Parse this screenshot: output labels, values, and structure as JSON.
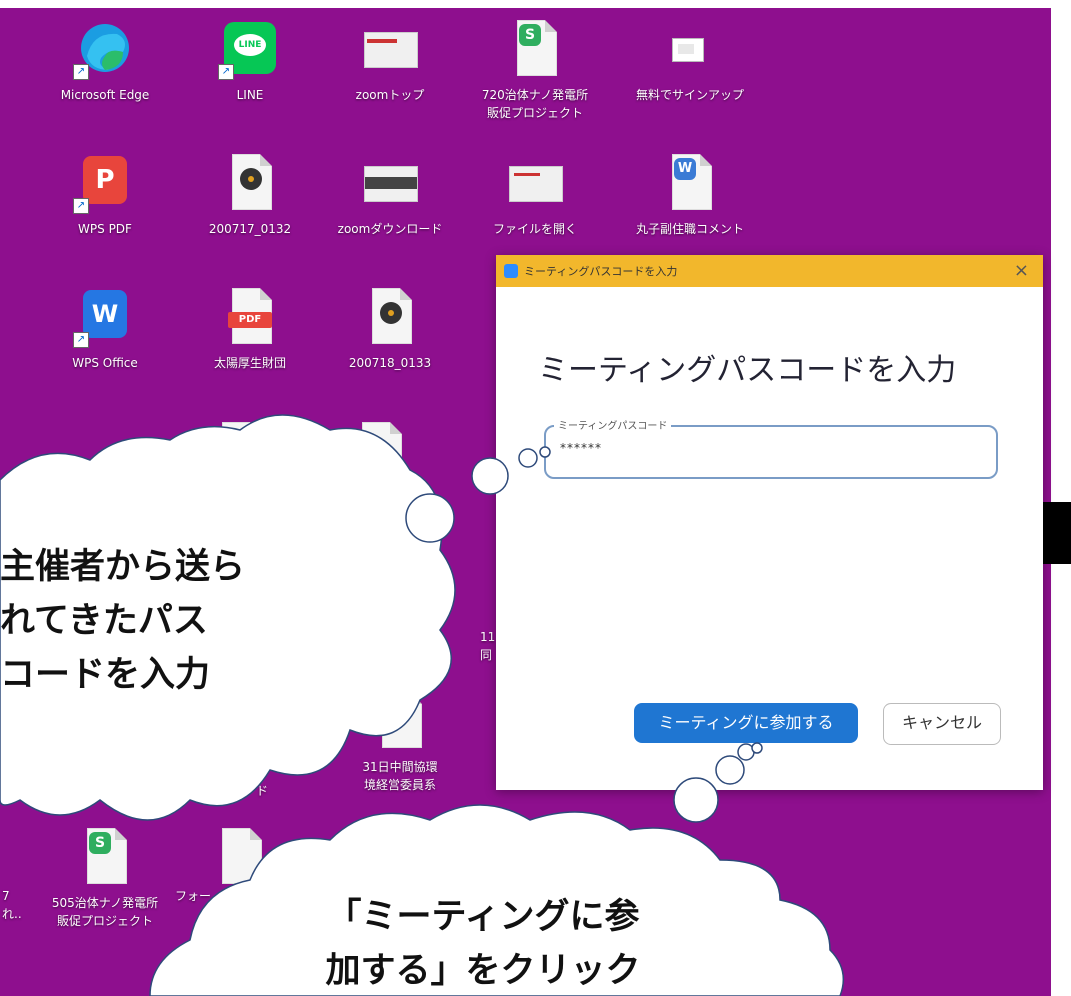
{
  "desktop": {
    "background_color": "#8e0f8e",
    "icons": [
      {
        "name": "desktop-icon-edge",
        "label": "Microsoft Edge"
      },
      {
        "name": "desktop-icon-line",
        "label": "LINE",
        "badge": "LINE"
      },
      {
        "name": "desktop-icon-zoom-top",
        "label": "zoomトップ"
      },
      {
        "name": "desktop-icon-720-project",
        "label": "720治体ナノ発電所\n販促プロジェクト",
        "badge": "S"
      },
      {
        "name": "desktop-icon-free-signup",
        "label": "無料でサインアップ"
      },
      {
        "name": "desktop-icon-wps-pdf",
        "label": "WPS PDF"
      },
      {
        "name": "desktop-icon-200717",
        "label": "200717_0132"
      },
      {
        "name": "desktop-icon-zoom-download",
        "label": "zoomダウンロード"
      },
      {
        "name": "desktop-icon-open-file",
        "label": "ファイルを開く"
      },
      {
        "name": "desktop-icon-comment",
        "label": "丸子副住職コメント",
        "badge": "W"
      },
      {
        "name": "desktop-icon-wps-office",
        "label": "WPS Office"
      },
      {
        "name": "desktop-icon-taiyo",
        "label": "太陽厚生財団",
        "badge": "PDF"
      },
      {
        "name": "desktop-icon-200718",
        "label": "200718_0133"
      },
      {
        "name": "desktop-icon-31-meeting",
        "label": "31日中間協環\n境経営委員系"
      },
      {
        "name": "desktop-icon-505-project",
        "label": "505治体ナノ発電所\n販促プロジェクト",
        "badge": "S"
      }
    ],
    "partial_labels": {
      "left_bottom": "7\nれ..",
      "fo": "フォー",
      "do": "ド",
      "num11": "11\n同"
    }
  },
  "dialog": {
    "title": "ミーティングパスコードを入力",
    "close_glyph": "×",
    "heading": "ミーティングパスコードを入力",
    "field_label": "ミーティングパスコード",
    "field_value": "******",
    "join_label": "ミーティングに参加する",
    "cancel_label": "キャンセル",
    "title_bar_color": "#f2b72c",
    "join_color": "#1f76d2"
  },
  "annotations": {
    "cloud1": "主催者から送ら\nれてきたパス\nコードを入力",
    "cloud2": "「ミーティングに参\n加する」をクリック"
  }
}
